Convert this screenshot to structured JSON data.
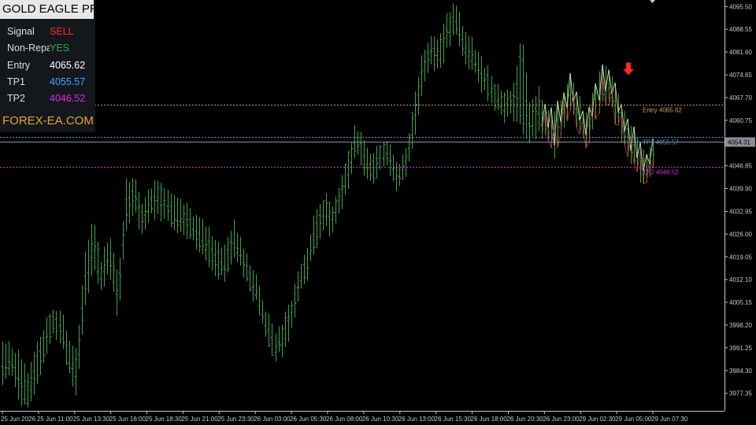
{
  "panel": {
    "title": "GOLD EAGLE PRO",
    "rows": [
      {
        "label": "Signal",
        "value": "SELL",
        "color": "#ff2a2a"
      },
      {
        "label": "Non-Repaint",
        "value": "YES",
        "color": "#2ea84a"
      },
      {
        "label": "Entry",
        "value": "4065.62",
        "color": "#ffffff"
      },
      {
        "label": "TP1",
        "value": "4055.57",
        "color": "#3fa7ff"
      },
      {
        "label": "TP2",
        "value": "4046.52",
        "color": "#e02be0"
      }
    ],
    "brand": "FOREX-EA.COM"
  },
  "chart_data": {
    "type": "bar",
    "symbol_note": "OHLC price chart",
    "price_axis": {
      "min": 3972.0,
      "max": 4097.5,
      "ticks": [
        "4095.50",
        "4088.55",
        "4081.60",
        "4074.65",
        "4067.70",
        "4060.75",
        "4053.80",
        "4046.85",
        "4039.90",
        "4032.95",
        "4026.00",
        "4019.05",
        "4012.10",
        "4005.15",
        "3998.20",
        "3991.25",
        "3984.30",
        "3977.35"
      ],
      "current_price": "4054.31"
    },
    "time_axis": {
      "labels": [
        "25 Jun 2026",
        "25 Jun 11:00",
        "25 Jun 13:30",
        "25 Jun 16:00",
        "25 Jun 18:30",
        "25 Jun 21:00",
        "25 Jun 23:30",
        "26 Jun 03:00",
        "26 Jun 05:30",
        "26 Jun 08:00",
        "26 Jun 10:30",
        "26 Jun 13:00",
        "26 Jun 15:30",
        "26 Jun 18:00",
        "26 Jun 20:30",
        "26 Jun 23:00",
        "29 Jun 02:30",
        "29 Jun 05:00",
        "29 Jun 07:30"
      ]
    },
    "levels": [
      {
        "name": "Entry",
        "label": "Entry 4065.62",
        "price": 4065.62,
        "color": "#d7a040"
      },
      {
        "name": "TP1",
        "label": "TP1 4055.57",
        "price": 4055.57,
        "color": "#4aa0e0"
      },
      {
        "name": "TP2",
        "label": "TP2 4046.52",
        "price": 4046.52,
        "color": "#d030d0"
      }
    ],
    "signal": {
      "type": "SELL",
      "price": 4075.5,
      "color": "#ff2a2a"
    },
    "bar_color": "#3fa34d",
    "key_prices": [
      [
        3985.5,
        3981,
        3993,
        3983
      ],
      [
        3987,
        3983,
        3992,
        3986
      ],
      [
        3982.5,
        3976,
        3990,
        3980
      ],
      [
        3975,
        3971,
        3983,
        3979
      ],
      [
        3985,
        3979,
        3992,
        3983
      ],
      [
        3993,
        3987,
        3997,
        3990
      ],
      [
        4001,
        3995,
        4003,
        3998
      ],
      [
        3998,
        3994,
        4004,
        3996
      ],
      [
        3987,
        3983,
        3994,
        3985
      ],
      [
        3983,
        3977,
        3990,
        3987
      ],
      [
        4012,
        4004,
        4020,
        4010
      ],
      [
        4022,
        4015,
        4032,
        4025
      ],
      [
        4012,
        4007,
        4018,
        4015
      ],
      [
        4020,
        4015,
        4027,
        4019
      ],
      [
        4005,
        4000,
        4012,
        4008
      ],
      [
        4035,
        4028,
        4042,
        4033
      ],
      [
        4040,
        4033,
        4045,
        4037
      ],
      [
        4032,
        4026,
        4036,
        4030
      ],
      [
        4036,
        4031,
        4040,
        4034
      ],
      [
        4037,
        4031,
        4044,
        4040
      ],
      [
        4035,
        4030,
        4040,
        4033
      ],
      [
        4030,
        4026,
        4036,
        4028
      ],
      [
        4030,
        4025,
        4035,
        4032
      ],
      [
        4028,
        4023,
        4033,
        4026
      ],
      [
        4025,
        4020,
        4030,
        4023
      ],
      [
        4022,
        4017,
        4028,
        4020
      ],
      [
        4019,
        4014,
        4024,
        4016
      ],
      [
        4017,
        4012,
        4022,
        4014
      ],
      [
        4024,
        4019,
        4030,
        4022
      ],
      [
        4020,
        4016,
        4025,
        4018
      ],
      [
        4013,
        4009,
        4018,
        4011
      ],
      [
        4008,
        4004,
        4012,
        4006
      ],
      [
        3998,
        3994,
        4003,
        3996
      ],
      [
        3991,
        3988,
        3996,
        3989
      ],
      [
        3993,
        3989,
        3999,
        3997
      ],
      [
        4001,
        3996,
        4006,
        4004
      ],
      [
        4012,
        4007,
        4016,
        4010
      ],
      [
        4018,
        4013,
        4022,
        4016
      ],
      [
        4027,
        4022,
        4033,
        4025
      ],
      [
        4033,
        4028,
        4038,
        4036
      ],
      [
        4030,
        4026,
        4035,
        4032
      ],
      [
        4037,
        4033,
        4042,
        4039
      ],
      [
        4046,
        4041,
        4051,
        4049
      ],
      [
        4055,
        4050,
        4060,
        4053
      ],
      [
        4049,
        4045,
        4053,
        4046
      ],
      [
        4046,
        4042,
        4050,
        4044
      ],
      [
        4051,
        4047,
        4055,
        4053
      ],
      [
        4050,
        4045,
        4054,
        4047
      ],
      [
        4043,
        4039,
        4047,
        4041
      ],
      [
        4048,
        4043,
        4053,
        4051
      ],
      [
        4061,
        4056,
        4067,
        4064
      ],
      [
        4076,
        4071,
        4082,
        4079
      ],
      [
        4083,
        4078,
        4088,
        4081
      ],
      [
        4080,
        4076,
        4085,
        4082
      ],
      [
        4087,
        4082,
        4093,
        4090
      ],
      [
        4092,
        4087,
        4097,
        4089
      ],
      [
        4084,
        4079,
        4089,
        4082
      ],
      [
        4081,
        4076,
        4085,
        4079
      ],
      [
        4076,
        4071,
        4080,
        4074
      ],
      [
        4073,
        4068,
        4077,
        4070
      ],
      [
        4068,
        4064,
        4072,
        4066
      ],
      [
        4065,
        4061,
        4069,
        4067
      ],
      [
        4067,
        4062,
        4071,
        4069
      ],
      [
        4082,
        4058,
        4087,
        4062
      ],
      [
        4058,
        4054,
        4066,
        4060
      ],
      [
        4064,
        4056,
        4071,
        4067
      ],
      [
        4060,
        4055,
        4065,
        4058
      ],
      [
        4057,
        4050,
        4063,
        4055
      ],
      [
        4063,
        4058,
        4068,
        4066
      ],
      [
        4070,
        4064,
        4076,
        4068
      ],
      [
        4064,
        4058,
        4069,
        4060
      ],
      [
        4056,
        4052,
        4061,
        4058
      ],
      [
        4067,
        4062,
        4073,
        4069
      ],
      [
        4072,
        4066,
        4078,
        4070
      ],
      [
        4068,
        4064,
        4073,
        4066
      ],
      [
        4062,
        4056,
        4067,
        4060
      ],
      [
        4056,
        4050,
        4062,
        4054
      ],
      [
        4050,
        4045,
        4056,
        4048
      ],
      [
        4045,
        4040,
        4050,
        4047
      ],
      [
        4050,
        4046,
        4055,
        4052
      ]
    ]
  }
}
